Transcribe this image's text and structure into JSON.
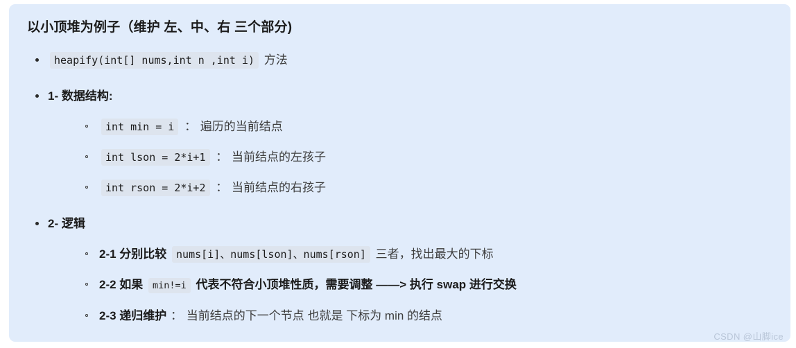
{
  "card": {
    "background_color": "#e1ecfb",
    "title": "以小顶堆为例子（维护 左、中、右 三个部分)"
  },
  "items": {
    "item1": {
      "code": "heapify(int[] nums,int n ,int i)",
      "trailing_text": "方法"
    },
    "item2": {
      "label": "1- 数据结构:",
      "subitems": [
        {
          "code": "int min = i",
          "separator": "：",
          "text": "遍历的当前结点"
        },
        {
          "code": "int lson = 2*i+1",
          "separator": "：",
          "text": "当前结点的左孩子"
        },
        {
          "code": "int rson = 2*i+2",
          "separator": "：",
          "text": "当前结点的右孩子"
        }
      ]
    },
    "item3": {
      "label": "2- 逻辑",
      "subitems": [
        {
          "lead": "2-1 分别比较",
          "code": "nums[i]、nums[lson]、nums[rson]",
          "tail": "三者，找出最大的下标"
        },
        {
          "lead": "2-2 如果",
          "code": "min!=i",
          "tail": "代表不符合小顶堆性质，需要调整 ——> 执行 swap 进行交换"
        },
        {
          "lead": "2-3 递归维护",
          "separator": "：",
          "tail": "当前结点的下一个节点 也就是 下标为 min 的结点"
        }
      ]
    }
  },
  "watermark": {
    "text": "CSDN @山脚ice",
    "color": "#b9c6d8"
  }
}
